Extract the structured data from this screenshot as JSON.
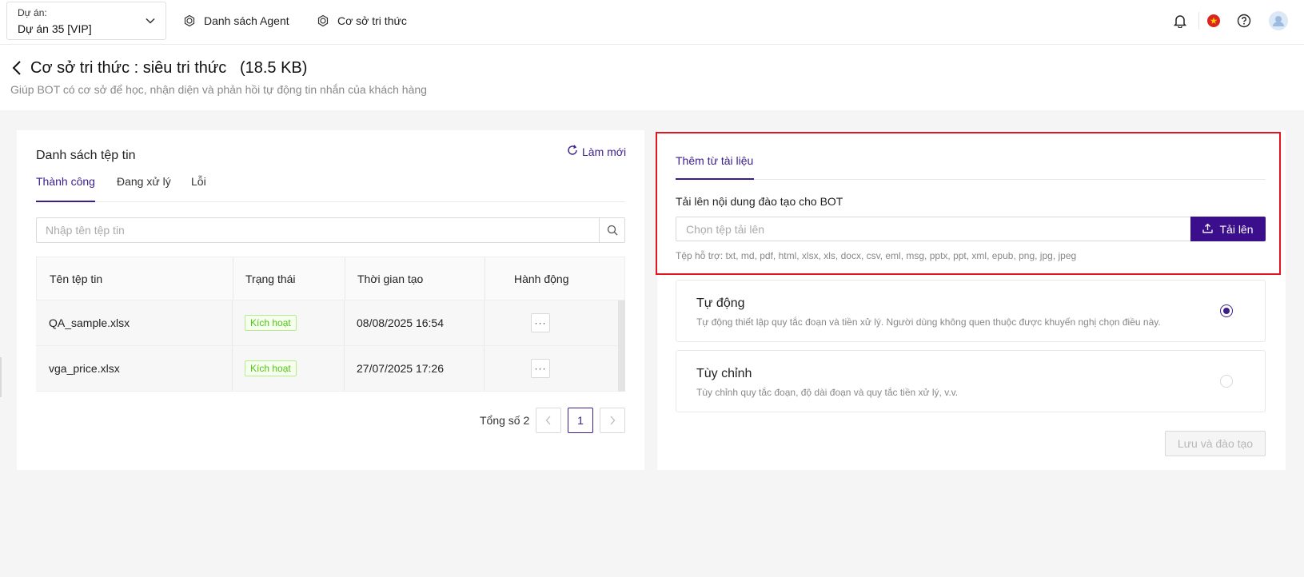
{
  "topbar": {
    "project_label": "Dự án:",
    "project_value": "Dự án 35 [VIP]",
    "nav": [
      {
        "label": "Danh sách Agent",
        "icon": "openai-icon"
      },
      {
        "label": "Cơ sở tri thức",
        "icon": "openai-icon"
      }
    ],
    "icons": [
      "bell-icon",
      "vietnam-flag-icon",
      "help-icon",
      "avatar"
    ]
  },
  "header": {
    "title": "Cơ sở tri thức : siêu tri thức   (18.5 KB)",
    "subtitle": "Giúp BOT có cơ sở để học, nhận diện và phản hồi tự động tin nhắn của khách hàng"
  },
  "file_list": {
    "title": "Danh sách tệp tin",
    "refresh_label": "Làm mới",
    "tabs": [
      "Thành công",
      "Đang xử lý",
      "Lỗi"
    ],
    "search_placeholder": "Nhập tên tệp tin",
    "columns": [
      "Tên tệp tin",
      "Trạng thái",
      "Thời gian tạo",
      "Hành động"
    ],
    "rows": [
      {
        "name": "QA_sample.xlsx",
        "status": "Kích hoạt",
        "created": "08/08/2025 16:54",
        "action": "···"
      },
      {
        "name": "vga_price.xlsx",
        "status": "Kích hoạt",
        "created": "27/07/2025 17:26",
        "action": "···"
      }
    ],
    "pagination": {
      "total_label": "Tổng số 2",
      "current_page": "1"
    }
  },
  "upload": {
    "tab_label": "Thêm từ tài liệu",
    "label": "Tải lên nội dung đào tạo cho BOT",
    "input_placeholder": "Chọn tệp tải lên",
    "button_label": "Tải lên",
    "supported": "Tệp hỗ trợ: txt, md, pdf, html, xlsx, xls, docx, csv, eml, msg, pptx, ppt, xml, epub, png, jpg, jpeg"
  },
  "options": [
    {
      "title": "Tự động",
      "description": "Tự động thiết lập quy tắc đoạn và tiền xử lý. Người dùng không quen thuộc được khuyến nghị chọn điều này.",
      "selected": true
    },
    {
      "title": "Tùy chỉnh",
      "description": "Tùy chỉnh quy tắc đoạn, độ dài đoạn và quy tắc tiền xử lý, v.v.",
      "selected": false
    }
  ],
  "save_button_label": "Lưu và đào tạo",
  "colors": {
    "accent": "#3b1e8a",
    "upload_button": "#3b0f8c",
    "highlight_border": "#e5141e",
    "badge_green": "#52c41a"
  }
}
